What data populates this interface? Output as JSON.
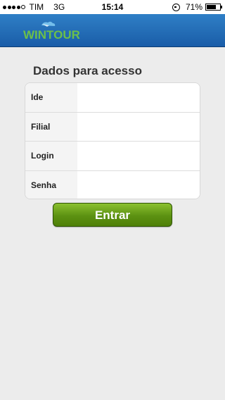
{
  "status_bar": {
    "carrier": "TIM",
    "network": "3G",
    "time": "15:14",
    "battery_percent": "71%",
    "battery_level": 0.71,
    "signal_bars_filled": 4,
    "signal_bars_total": 5
  },
  "header": {
    "logo_text": "WINTOUR",
    "background_color": "#1e66b2",
    "logo_color": "#6cc04a"
  },
  "form": {
    "title": "Dados para acesso",
    "fields": [
      {
        "label": "Ide",
        "value": "",
        "placeholder": ""
      },
      {
        "label": "Filial",
        "value": "",
        "placeholder": ""
      },
      {
        "label": "Login",
        "value": "",
        "placeholder": ""
      },
      {
        "label": "Senha",
        "value": "",
        "placeholder": ""
      }
    ],
    "submit_label": "Entrar",
    "submit_color": "#5c9112"
  }
}
